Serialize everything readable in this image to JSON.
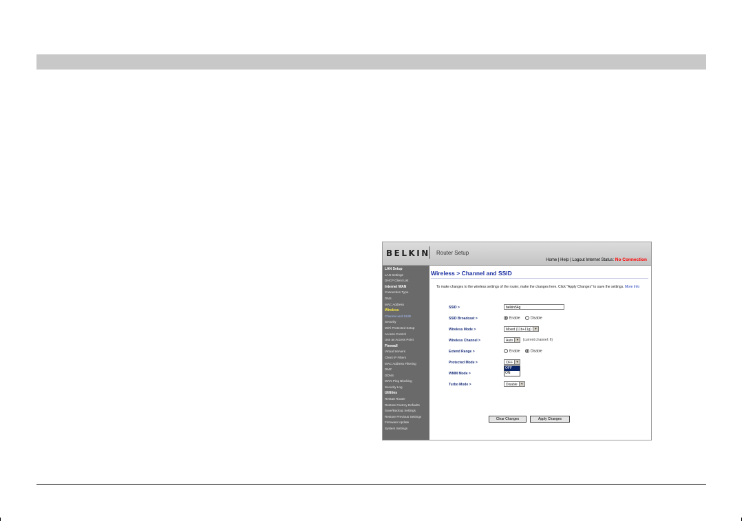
{
  "router": {
    "brand": "BELKIN",
    "app_title": "Router Setup",
    "top_links": {
      "home": "Home",
      "help": "Help",
      "logout": "Logout",
      "status_label": "Internet Status:",
      "status_value": "No Connection",
      "separator": "|"
    },
    "sidebar": {
      "lan_setup": "LAN Setup",
      "lan_settings": "LAN Settings",
      "dhcp_client_list": "DHCP Client List",
      "internet_wan": "Internet WAN",
      "connection_type": "Connection Type",
      "dns": "DNS",
      "mac_address": "MAC Address",
      "wireless": "Wireless",
      "channel_and_ssid": "Channel and SSID",
      "security": "Security",
      "wps": "WiFi Protected Setup",
      "access_control": "Access Control",
      "use_as_ap": "Use as Access Point",
      "firewall": "Firewall",
      "virtual_servers": "Virtual Servers",
      "client_ip_filters": "Client IP Filters",
      "mac_address_filtering": "MAC Address Filtering",
      "dmz": "DMZ",
      "ddns": "DDNS",
      "wan_ping_blocking": "WAN Ping Blocking",
      "security_log": "Security Log",
      "utilities": "Utilities",
      "restart_router": "Restart Router",
      "restore_factory": "Restore Factory Defaults",
      "save_backup": "Save/Backup Settings",
      "restore_previous": "Restore Previous Settings",
      "firmware_update": "Firmware Update",
      "system_settings": "System Settings"
    },
    "main": {
      "title": "Wireless > Channel and SSID",
      "intro": "To make changes to the wireless settings of the router, make the changes here. Click \"Apply Changes\" to save the settings.",
      "more_info": "More Info",
      "ssid_label": "SSID >",
      "ssid_value": "belkin54g",
      "ssid_broadcast_label": "SSID Broadcast >",
      "enable": "Enable",
      "disable": "Disable",
      "wireless_mode_label": "Wireless Mode >",
      "wireless_mode_value": "Mixed (11b+11g)",
      "wireless_channel_label": "Wireless Channel >",
      "wireless_channel_value": "Auto",
      "current_channel_note": "(current channel: 6)",
      "extend_range_label": "Extend Range >",
      "protected_mode_label": "Protected Mode >",
      "protected_mode_value": "OFF",
      "protected_mode_options": [
        "OFF",
        "ON"
      ],
      "wmm_mode_label": "WMM Mode >",
      "turbo_mode_label": "Turbo Mode >",
      "turbo_mode_value": "Disable",
      "clear_button": "Clear Changes",
      "apply_button": "Apply Changes"
    }
  }
}
